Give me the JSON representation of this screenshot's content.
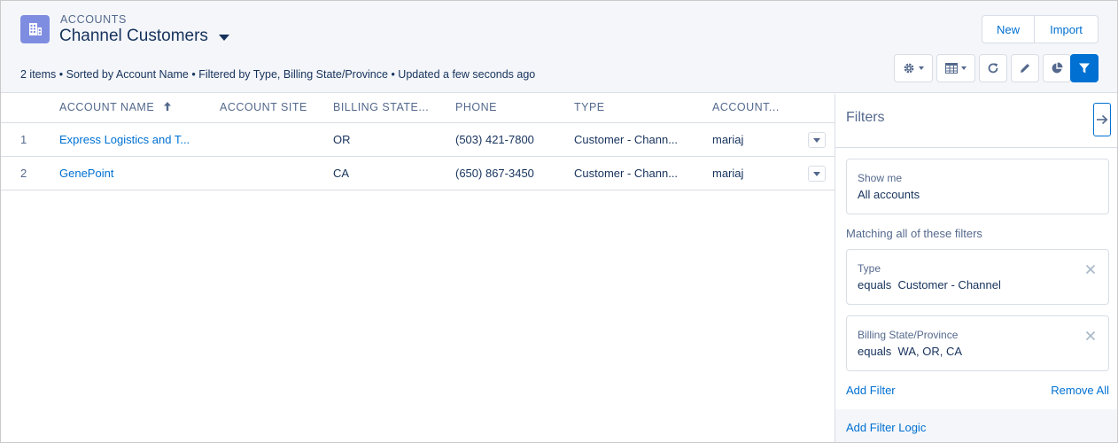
{
  "header": {
    "object_label": "ACCOUNTS",
    "title": "Channel Customers",
    "meta": "2 items • Sorted by Account Name • Filtered by Type, Billing State/Province • Updated a few seconds ago",
    "new_label": "New",
    "import_label": "Import",
    "icons": [
      "grid-object-icon",
      "gear-icon",
      "table-view-icon",
      "refresh-icon",
      "pencil-icon",
      "pie-chart-icon",
      "filter-icon"
    ],
    "accent_color": "#0070d2",
    "object_icon_color": "#7f8de1"
  },
  "table": {
    "columns": [
      "ACCOUNT NAME",
      "ACCOUNT SITE",
      "BILLING STATE...",
      "PHONE",
      "TYPE",
      "ACCOUNT..."
    ],
    "sorted_column": "ACCOUNT NAME",
    "sort_direction": "ascending",
    "rows": [
      {
        "num": "1",
        "name": "Express Logistics and T...",
        "site": "",
        "state": "OR",
        "phone": "(503) 421-7800",
        "type": "Customer - Chann...",
        "owner": "mariaj"
      },
      {
        "num": "2",
        "name": "GenePoint",
        "site": "",
        "state": "CA",
        "phone": "(650) 867-3450",
        "type": "Customer - Chann...",
        "owner": "mariaj"
      }
    ]
  },
  "filters": {
    "title": "Filters",
    "show_me": {
      "label": "Show me",
      "value": "All accounts"
    },
    "matching_text": "Matching all of these filters",
    "items": [
      {
        "label": "Type",
        "value": "equals  Customer - Channel"
      },
      {
        "label": "Billing State/Province",
        "value": "equals  WA, OR, CA"
      }
    ],
    "add_filter": "Add Filter",
    "remove_all": "Remove All",
    "add_filter_logic": "Add Filter Logic"
  }
}
